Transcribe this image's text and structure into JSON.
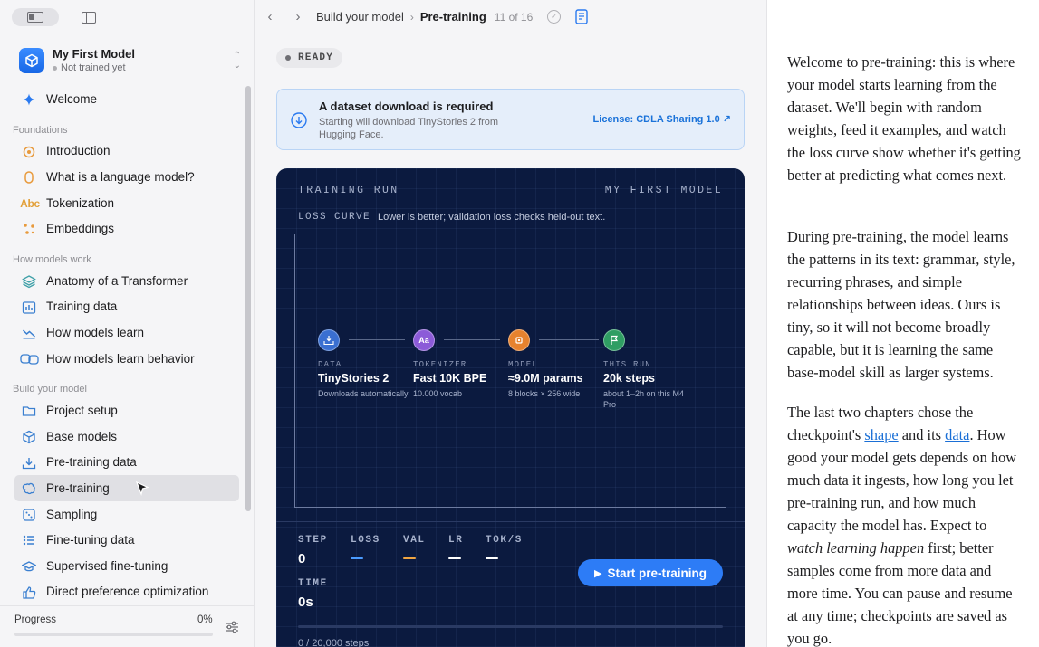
{
  "app": {
    "model_name": "My First Model",
    "model_status": "Not trained yet"
  },
  "sidebar": {
    "welcome": "Welcome",
    "sections": [
      {
        "title": "Foundations",
        "items": [
          "Introduction",
          "What is a language model?",
          "Tokenization",
          "Embeddings"
        ]
      },
      {
        "title": "How models work",
        "items": [
          "Anatomy of a Transformer",
          "Training data",
          "How models learn",
          "How models learn behavior"
        ]
      },
      {
        "title": "Build your model",
        "items": [
          "Project setup",
          "Base models",
          "Pre-training data",
          "Pre-training",
          "Sampling",
          "Fine-tuning data",
          "Supervised fine-tuning",
          "Direct preference optimization"
        ]
      }
    ],
    "active_item": "Pre-training",
    "tokenization_icon_text": "Abc",
    "progress": {
      "label": "Progress",
      "percent_text": "0%",
      "fraction": 0
    }
  },
  "toolbar": {
    "crumb_parent": "Build your model",
    "crumb_current": "Pre-training",
    "counter": "11 of 16"
  },
  "main": {
    "status_badge": "READY",
    "notice": {
      "title": "A dataset download is required",
      "body": "Starting will download TinyStories 2 from Hugging Face.",
      "license": "License: CDLA Sharing 1.0 ↗"
    },
    "panel": {
      "kicker_left": "TRAINING RUN",
      "kicker_right": "MY FIRST MODEL",
      "loss_label": "LOSS CURVE",
      "loss_desc": "Lower is better; validation loss checks held-out text.",
      "pipeline": [
        {
          "label": "DATA",
          "value": "TinyStories 2",
          "desc": "Downloads automatically",
          "icon": "download-tray-icon",
          "color": "#3a6fd1"
        },
        {
          "label": "TOKENIZER",
          "value": "Fast 10K BPE",
          "desc": "10.000 vocab",
          "icon": "Aa",
          "color": "#8c5bd8"
        },
        {
          "label": "MODEL",
          "value": "≈9.0M params",
          "desc": "8 blocks × 256 wide",
          "icon": "chip-icon",
          "color": "#e6822e"
        },
        {
          "label": "THIS RUN",
          "value": "20k steps",
          "desc": "about 1–2h on this M4 Pro",
          "icon": "flag-icon",
          "color": "#2f9e63"
        }
      ],
      "stats": {
        "step_label": "STEP",
        "step_value": "0",
        "loss_label": "LOSS",
        "val_label": "VAL",
        "lr_label": "LR",
        "toks_label": "TOK/S",
        "time_label": "TIME",
        "time_value": "0s"
      },
      "start_button": "Start pre-training",
      "run_progress_text": "0 / 20,000 steps",
      "run_fraction": 0
    }
  },
  "reader": {
    "p1": "Welcome to pre-training: this is where your model starts learning from the dataset. We'll begin with random weights, feed it examples, and watch the loss curve show whether it's getting better at predicting what comes next.",
    "p2": "During pre-training, the model learns the patterns in its text: grammar, style, recurring phrases, and simple relationships between ideas. Ours is tiny, so it will not become broadly capable, but it is learning the same base-model skill as larger systems.",
    "p3_a": "The last two chapters chose the checkpoint's ",
    "p3_link1": "shape",
    "p3_b": " and its ",
    "p3_link2": "data",
    "p3_c": ". How good your model gets depends on how much data it ingests, how long you let pre-training run, and how much capacity the model has. Expect to ",
    "p3_em": "watch learning happen",
    "p3_d": " first; better samples come from more data and more time. You can pause and resume at any time; checkpoints are saved as you go."
  },
  "colors": {
    "accent": "#2d7cf6",
    "panel_bg": "#0b1a3f",
    "loss_dash": "#4a9bff",
    "val_dash": "#f0a542"
  }
}
